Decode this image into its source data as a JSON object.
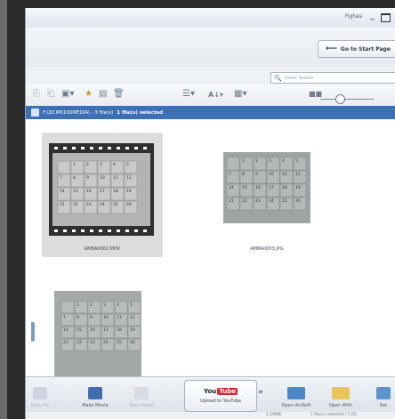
{
  "titlebar": {
    "user": "Fighas"
  },
  "header": {
    "start_page_button": "Go to Start Page"
  },
  "search": {
    "placeholder": "Quick Search"
  },
  "toolbar": {
    "sort_label": "A"
  },
  "pathbar": {
    "path": "F:\\DCIM\\100MEDIA\\ - 3 file(s)",
    "selection": "1 file(s) selected"
  },
  "files": [
    {
      "name": "AMBA0002.MOV",
      "type": "video",
      "selected": true
    },
    {
      "name": "AMBA0003.JPG",
      "type": "image",
      "selected": false
    },
    {
      "name": "",
      "type": "image",
      "selected": false
    }
  ],
  "bottom": {
    "easy_fix": "Easy Fix",
    "make_movie": "Make Movie",
    "easy_email": "Easy Email",
    "youtube_you": "You",
    "youtube_tube": "Tube",
    "upload_youtube": "Upload to YouTube",
    "open_arcsoft": "Open ArcSoft",
    "open_with": "Open With",
    "settings": "Set"
  },
  "status": {
    "left": "1.59MB",
    "right": "1 file(s) selected / 7.05"
  },
  "calendar_rows": [
    [
      "",
      "1",
      "2",
      "3",
      "4",
      "5"
    ],
    [
      "7",
      "8",
      "9",
      "10",
      "11",
      "12"
    ],
    [
      "14",
      "15",
      "16",
      "17",
      "18",
      "19"
    ],
    [
      "21",
      "22",
      "23",
      "24",
      "25",
      "26"
    ]
  ]
}
